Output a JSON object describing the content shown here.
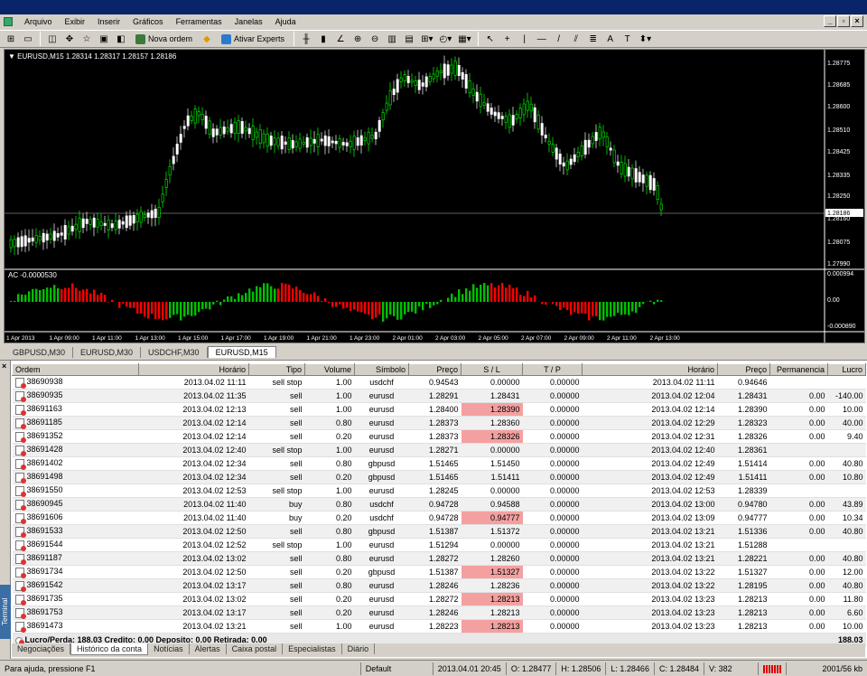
{
  "menu": [
    "Arquivo",
    "Exibir",
    "Inserir",
    "Gráficos",
    "Ferramentas",
    "Janelas",
    "Ajuda"
  ],
  "toolbar": {
    "new_order": "Nova ordem",
    "experts": "Ativar Experts"
  },
  "chart": {
    "symbol_line": "▼ EURUSD,M15  1.28314 1.28317 1.28157 1.28186",
    "price_ticks": [
      "1.28775",
      "1.28685",
      "1.28600",
      "1.28510",
      "1.28425",
      "1.28335",
      "1.28250",
      "1.28160",
      "1.28075",
      "1.27990"
    ],
    "current_price": "1.28186",
    "indicator_label": "AC -0.0000530",
    "indicator_ticks": [
      "0.000994",
      "0.00",
      "-0.000890"
    ],
    "time_ticks": [
      "1 Apr 2013",
      "1 Apr 09:00",
      "1 Apr 11:00",
      "1 Apr 13:00",
      "1 Apr 15:00",
      "1 Apr 17:00",
      "1 Apr 19:00",
      "1 Apr 21:00",
      "1 Apr 23:00",
      "2 Apr 01:00",
      "2 Apr 03:00",
      "2 Apr 05:00",
      "2 Apr 07:00",
      "2 Apr 09:00",
      "2 Apr 11:00",
      "2 Apr 13:00"
    ],
    "colors": {
      "background": "#000000",
      "bull": "#00ff00",
      "bear": "#ffffff",
      "ac_up": "#00c000",
      "ac_down": "#ff0000",
      "current_line": "#c0c0c0"
    }
  },
  "chart_tabs": [
    "GBPUSD,M30",
    "EURUSD,M30",
    "USDCHF,M30",
    "EURUSD,M15"
  ],
  "columns": [
    "Ordem",
    "Horário",
    "Tipo",
    "Volume",
    "Símbolo",
    "Preço",
    "S / L",
    "T / P",
    "Horário",
    "Preço",
    "Permanencia",
    "Lucro"
  ],
  "rows": [
    {
      "o": "38690938",
      "t": "2013.04.02 11:11",
      "ty": "sell stop",
      "v": "1.00",
      "s": "usdchf",
      "p": "0.94543",
      "sl": "0.00000",
      "hl": false,
      "tp": "0.00000",
      "t2": "2013.04.02 11:11",
      "p2": "0.94646",
      "pe": "",
      "l": ""
    },
    {
      "o": "38690935",
      "t": "2013.04.02 11:35",
      "ty": "sell",
      "v": "1.00",
      "s": "eurusd",
      "p": "1.28291",
      "sl": "1.28431",
      "hl": true,
      "tp": "0.00000",
      "t2": "2013.04.02 12:04",
      "p2": "1.28431",
      "pe": "0.00",
      "l": "-140.00"
    },
    {
      "o": "38691163",
      "t": "2013.04.02 12:13",
      "ty": "sell",
      "v": "1.00",
      "s": "eurusd",
      "p": "1.28400",
      "sl": "1.28390",
      "hl": true,
      "tp": "0.00000",
      "t2": "2013.04.02 12:14",
      "p2": "1.28390",
      "pe": "0.00",
      "l": "10.00"
    },
    {
      "o": "38691185",
      "t": "2013.04.02 12:14",
      "ty": "sell",
      "v": "0.80",
      "s": "eurusd",
      "p": "1.28373",
      "sl": "1.28360",
      "hl": false,
      "tp": "0.00000",
      "t2": "2013.04.02 12:29",
      "p2": "1.28323",
      "pe": "0.00",
      "l": "40.00"
    },
    {
      "o": "38691352",
      "t": "2013.04.02 12:14",
      "ty": "sell",
      "v": "0.20",
      "s": "eurusd",
      "p": "1.28373",
      "sl": "1.28326",
      "hl": true,
      "tp": "0.00000",
      "t2": "2013.04.02 12:31",
      "p2": "1.28326",
      "pe": "0.00",
      "l": "9.40"
    },
    {
      "o": "38691428",
      "t": "2013.04.02 12:40",
      "ty": "sell stop",
      "v": "1.00",
      "s": "eurusd",
      "p": "1.28271",
      "sl": "0.00000",
      "hl": false,
      "tp": "0.00000",
      "t2": "2013.04.02 12:40",
      "p2": "1.28361",
      "pe": "",
      "l": ""
    },
    {
      "o": "38691402",
      "t": "2013.04.02 12:34",
      "ty": "sell",
      "v": "0.80",
      "s": "gbpusd",
      "p": "1.51465",
      "sl": "1.51450",
      "hl": false,
      "tp": "0.00000",
      "t2": "2013.04.02 12:49",
      "p2": "1.51414",
      "pe": "0.00",
      "l": "40.80"
    },
    {
      "o": "38691498",
      "t": "2013.04.02 12:34",
      "ty": "sell",
      "v": "0.20",
      "s": "gbpusd",
      "p": "1.51465",
      "sl": "1.51411",
      "hl": true,
      "tp": "0.00000",
      "t2": "2013.04.02 12:49",
      "p2": "1.51411",
      "pe": "0.00",
      "l": "10.80"
    },
    {
      "o": "38691550",
      "t": "2013.04.02 12:53",
      "ty": "sell stop",
      "v": "1.00",
      "s": "eurusd",
      "p": "1.28245",
      "sl": "0.00000",
      "hl": false,
      "tp": "0.00000",
      "t2": "2013.04.02 12:53",
      "p2": "1.28339",
      "pe": "",
      "l": ""
    },
    {
      "o": "38690945",
      "t": "2013.04.02 11:40",
      "ty": "buy",
      "v": "0.80",
      "s": "usdchf",
      "p": "0.94728",
      "sl": "0.94588",
      "hl": false,
      "tp": "0.00000",
      "t2": "2013.04.02 13:00",
      "p2": "0.94780",
      "pe": "0.00",
      "l": "43.89"
    },
    {
      "o": "38691606",
      "t": "2013.04.02 11:40",
      "ty": "buy",
      "v": "0.20",
      "s": "usdchf",
      "p": "0.94728",
      "sl": "0.94777",
      "hl": true,
      "tp": "0.00000",
      "t2": "2013.04.02 13:09",
      "p2": "0.94777",
      "pe": "0.00",
      "l": "10.34"
    },
    {
      "o": "38691533",
      "t": "2013.04.02 12:50",
      "ty": "sell",
      "v": "0.80",
      "s": "gbpusd",
      "p": "1.51387",
      "sl": "1.51372",
      "hl": false,
      "tp": "0.00000",
      "t2": "2013.04.02 13:21",
      "p2": "1.51336",
      "pe": "0.00",
      "l": "40.80"
    },
    {
      "o": "38691544",
      "t": "2013.04.02 12:52",
      "ty": "sell stop",
      "v": "1.00",
      "s": "eurusd",
      "p": "1.51294",
      "sl": "0.00000",
      "hl": false,
      "tp": "0.00000",
      "t2": "2013.04.02 13:21",
      "p2": "1.51288",
      "pe": "",
      "l": ""
    },
    {
      "o": "38691187",
      "t": "2013.04.02 13:02",
      "ty": "sell",
      "v": "0.80",
      "s": "eurusd",
      "p": "1.28272",
      "sl": "1.28260",
      "hl": false,
      "tp": "0.00000",
      "t2": "2013.04.02 13:21",
      "p2": "1.28221",
      "pe": "0.00",
      "l": "40.80"
    },
    {
      "o": "38691734",
      "t": "2013.04.02 12:50",
      "ty": "sell",
      "v": "0.20",
      "s": "gbpusd",
      "p": "1.51387",
      "sl": "1.51327",
      "hl": true,
      "tp": "0.00000",
      "t2": "2013.04.02 13:22",
      "p2": "1.51327",
      "pe": "0.00",
      "l": "12.00"
    },
    {
      "o": "38691542",
      "t": "2013.04.02 13:17",
      "ty": "sell",
      "v": "0.80",
      "s": "eurusd",
      "p": "1.28246",
      "sl": "1.28236",
      "hl": false,
      "tp": "0.00000",
      "t2": "2013.04.02 13:22",
      "p2": "1.28195",
      "pe": "0.00",
      "l": "40.80"
    },
    {
      "o": "38691735",
      "t": "2013.04.02 13:02",
      "ty": "sell",
      "v": "0.20",
      "s": "eurusd",
      "p": "1.28272",
      "sl": "1.28213",
      "hl": true,
      "tp": "0.00000",
      "t2": "2013.04.02 13:23",
      "p2": "1.28213",
      "pe": "0.00",
      "l": "11.80"
    },
    {
      "o": "38691753",
      "t": "2013.04.02 13:17",
      "ty": "sell",
      "v": "0.20",
      "s": "eurusd",
      "p": "1.28246",
      "sl": "1.28213",
      "hl": true,
      "tp": "0.00000",
      "t2": "2013.04.02 13:23",
      "p2": "1.28213",
      "pe": "0.00",
      "l": "6.60"
    },
    {
      "o": "38691473",
      "t": "2013.04.02 13:21",
      "ty": "sell",
      "v": "1.00",
      "s": "eurusd",
      "p": "1.28223",
      "sl": "1.28213",
      "hl": true,
      "tp": "0.00000",
      "t2": "2013.04.02 13:23",
      "p2": "1.28213",
      "pe": "0.00",
      "l": "10.00"
    }
  ],
  "total": {
    "text": "Lucro/Perda: 188.03  Credito: 0.00  Deposito: 0.00  Retirada: 0.00",
    "value": "188.03"
  },
  "terminal_label": "Terminal",
  "bottom_tabs": [
    "Negociações",
    "Histórico da conta",
    "Notícias",
    "Alertas",
    "Caixa postal",
    "Especialistas",
    "Diário"
  ],
  "status": {
    "help": "Para ajuda, pressione F1",
    "profile": "Default",
    "datetime": "2013.04.01 20:45",
    "open": "O: 1.28477",
    "high": "H: 1.28506",
    "low": "L: 1.28466",
    "close": "C: 1.28484",
    "volume": "V: 382",
    "traffic": "2001/56 kb"
  }
}
